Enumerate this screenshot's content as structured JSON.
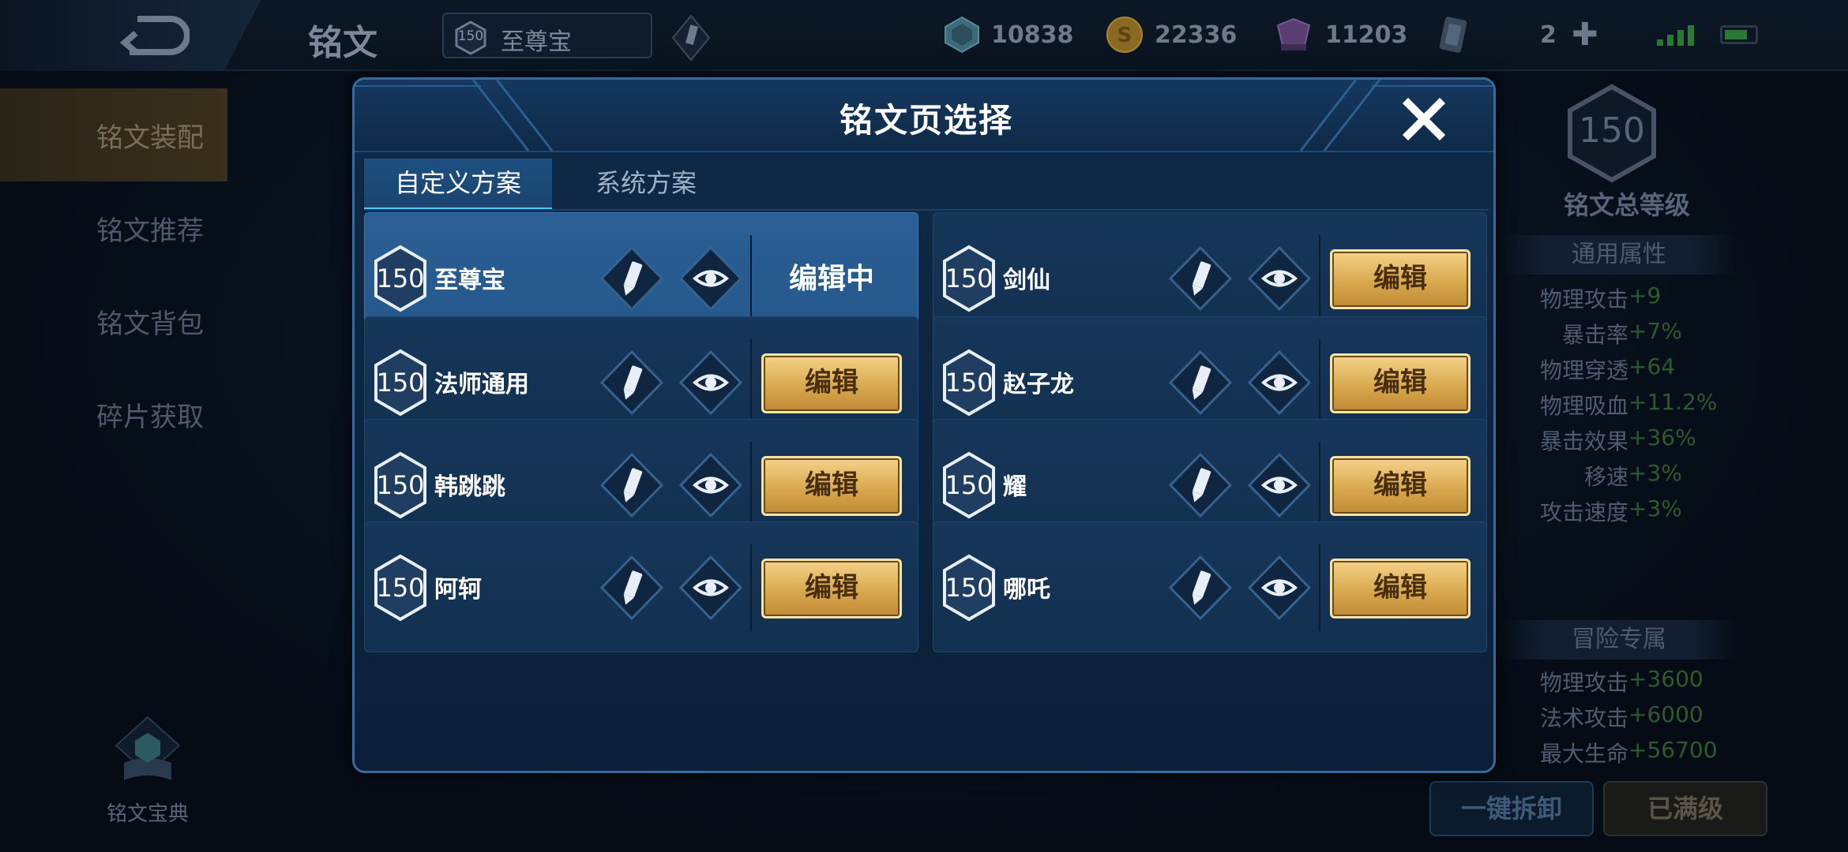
{
  "topbar": {
    "title": "铭文",
    "page_level": "150",
    "page_name": "至尊宝",
    "resources": {
      "gem": "10838",
      "gold": "22336",
      "crystal": "11203",
      "card": "2"
    }
  },
  "leftnav": {
    "items": [
      {
        "label": "铭文装配"
      },
      {
        "label": "铭文推荐"
      },
      {
        "label": "铭文背包"
      },
      {
        "label": "碎片获取"
      }
    ],
    "codex_label": "铭文宝典"
  },
  "rightpanel": {
    "level": "150",
    "level_title": "铭文总等级",
    "general_title": "通用属性",
    "general_attrs": [
      {
        "k": "物理攻击",
        "v": "+9"
      },
      {
        "k": "暴击率",
        "v": "+7%"
      },
      {
        "k": "物理穿透",
        "v": "+64"
      },
      {
        "k": "物理吸血",
        "v": "+11.2%"
      },
      {
        "k": "暴击效果",
        "v": "+36%"
      },
      {
        "k": "移速",
        "v": "+3%"
      },
      {
        "k": "攻击速度",
        "v": "+3%"
      }
    ],
    "adventure_title": "冒险专属",
    "adventure_attrs": [
      {
        "k": "物理攻击",
        "v": "+3600"
      },
      {
        "k": "法术攻击",
        "v": "+6000"
      },
      {
        "k": "最大生命",
        "v": "+56700"
      }
    ],
    "btn_dismantle": "一键拆卸",
    "btn_full": "已满级"
  },
  "modal": {
    "title": "铭文页选择",
    "tabs": [
      {
        "label": "自定义方案"
      },
      {
        "label": "系统方案"
      }
    ],
    "editing_label": "编辑中",
    "edit_label": "编辑",
    "cards": [
      {
        "level": "150",
        "name": "至尊宝"
      },
      {
        "level": "150",
        "name": "剑仙"
      },
      {
        "level": "150",
        "name": "法师通用"
      },
      {
        "level": "150",
        "name": "赵子龙"
      },
      {
        "level": "150",
        "name": "韩跳跳"
      },
      {
        "level": "150",
        "name": "耀"
      },
      {
        "level": "150",
        "name": "阿轲"
      },
      {
        "level": "150",
        "name": "哪吒"
      }
    ]
  }
}
